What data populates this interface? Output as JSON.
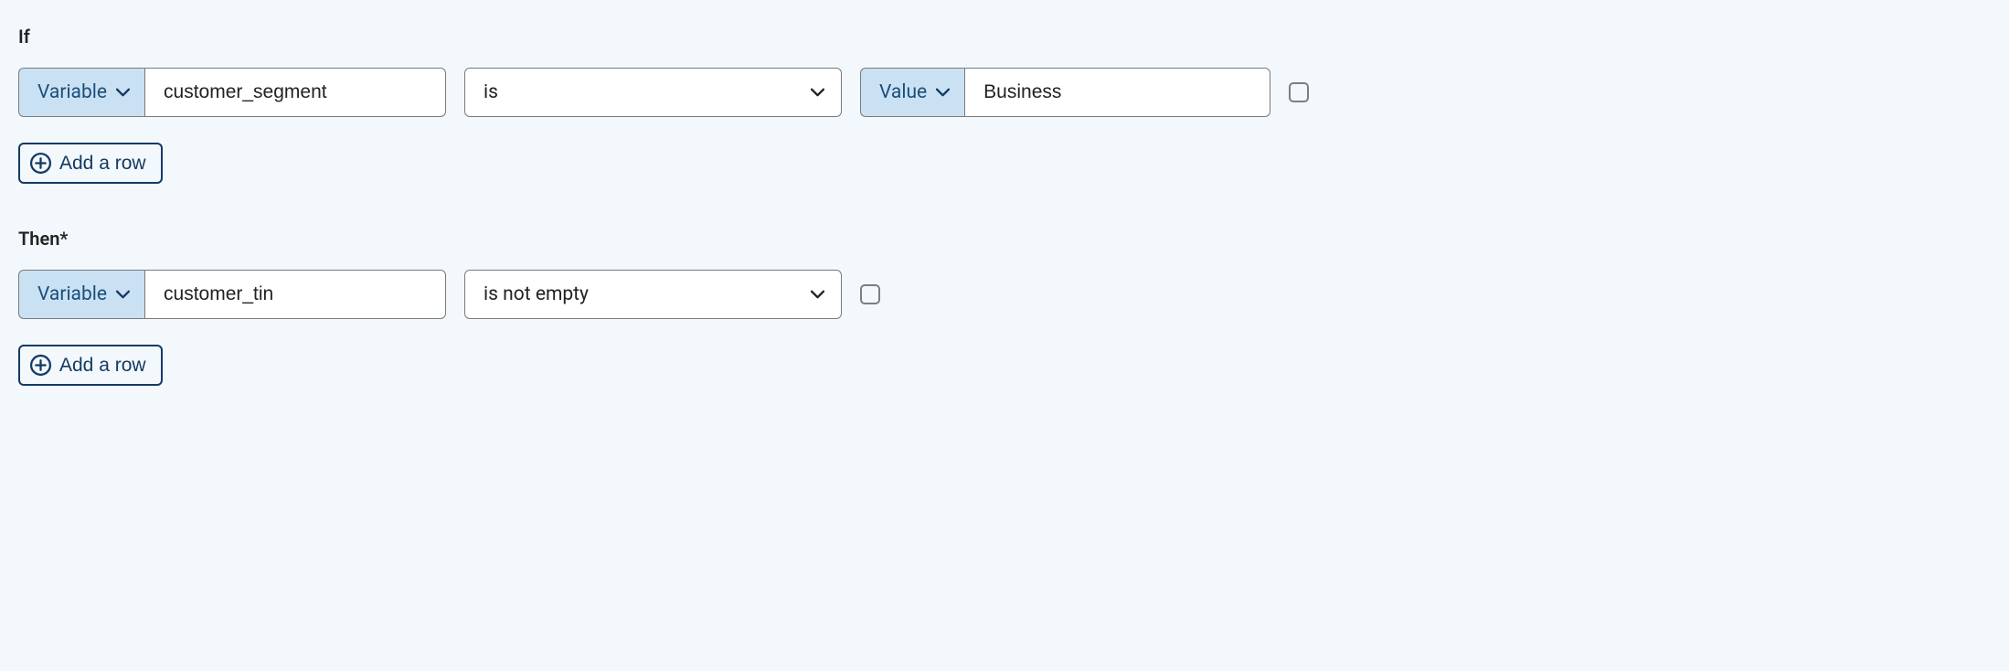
{
  "if": {
    "label": "If",
    "rows": [
      {
        "left_type_label": "Variable",
        "variable_name": "customer_segment",
        "operator": "is",
        "right_type_label": "Value",
        "value": "Business"
      }
    ],
    "add_row_label": "Add a row"
  },
  "then": {
    "label": "Then*",
    "rows": [
      {
        "left_type_label": "Variable",
        "variable_name": "customer_tin",
        "operator": "is not empty"
      }
    ],
    "add_row_label": "Add a row"
  }
}
